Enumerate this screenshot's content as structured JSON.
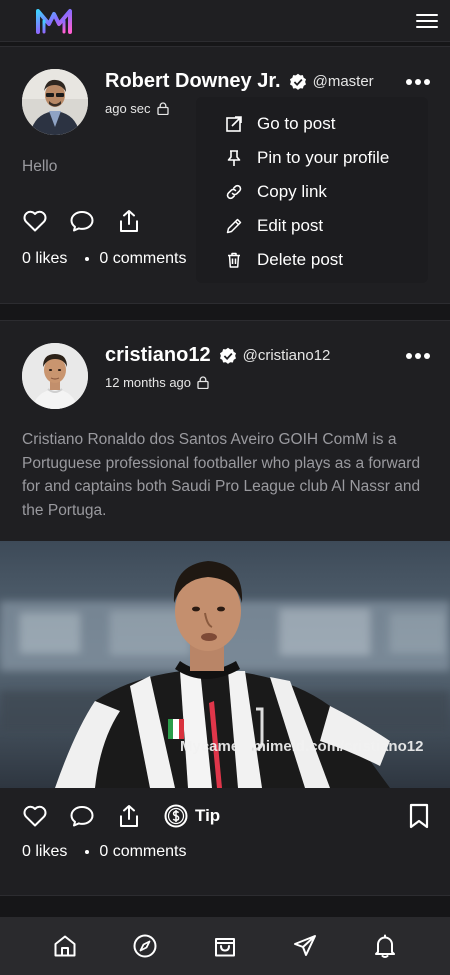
{
  "app": {
    "logo_icon": "app-logo-icon",
    "menu_icon": "hamburger-menu-icon"
  },
  "colors": {
    "background": "#161618",
    "card": "#1f1f22",
    "muted_text": "#9a9a9f",
    "nav": "#2a2a2d"
  },
  "posts": [
    {
      "name": "Robert Downey Jr.",
      "handle": "@master",
      "time": "ago sec",
      "text": "Hello",
      "likes": "0 likes",
      "comments": "0 comments"
    },
    {
      "name": "cristiano12",
      "handle": "@cristiano12",
      "time": "12 months ago",
      "text": "Cristiano Ronaldo dos Santos Aveiro GOIH ComM is a Portuguese professional footballer who plays as a forward for and captains both Saudi Pro League club Al Nassr and the Portuga.",
      "watermark": "Mycameo.mimeld.com/cristiano12",
      "tip_label": "Tip",
      "likes": "0 likes",
      "comments": "0 comments"
    }
  ],
  "dropdown": {
    "items": [
      {
        "label": "Go to post",
        "icon": "external-link-icon"
      },
      {
        "label": "Pin to your profile",
        "icon": "pin-icon"
      },
      {
        "label": "Copy link",
        "icon": "link-icon"
      },
      {
        "label": "Edit post",
        "icon": "pencil-icon"
      },
      {
        "label": "Delete post",
        "icon": "trash-icon"
      }
    ]
  },
  "bottom_nav": [
    {
      "icon": "home-icon"
    },
    {
      "icon": "compass-icon"
    },
    {
      "icon": "shopping-bag-icon"
    },
    {
      "icon": "send-icon"
    },
    {
      "icon": "bell-icon"
    }
  ]
}
